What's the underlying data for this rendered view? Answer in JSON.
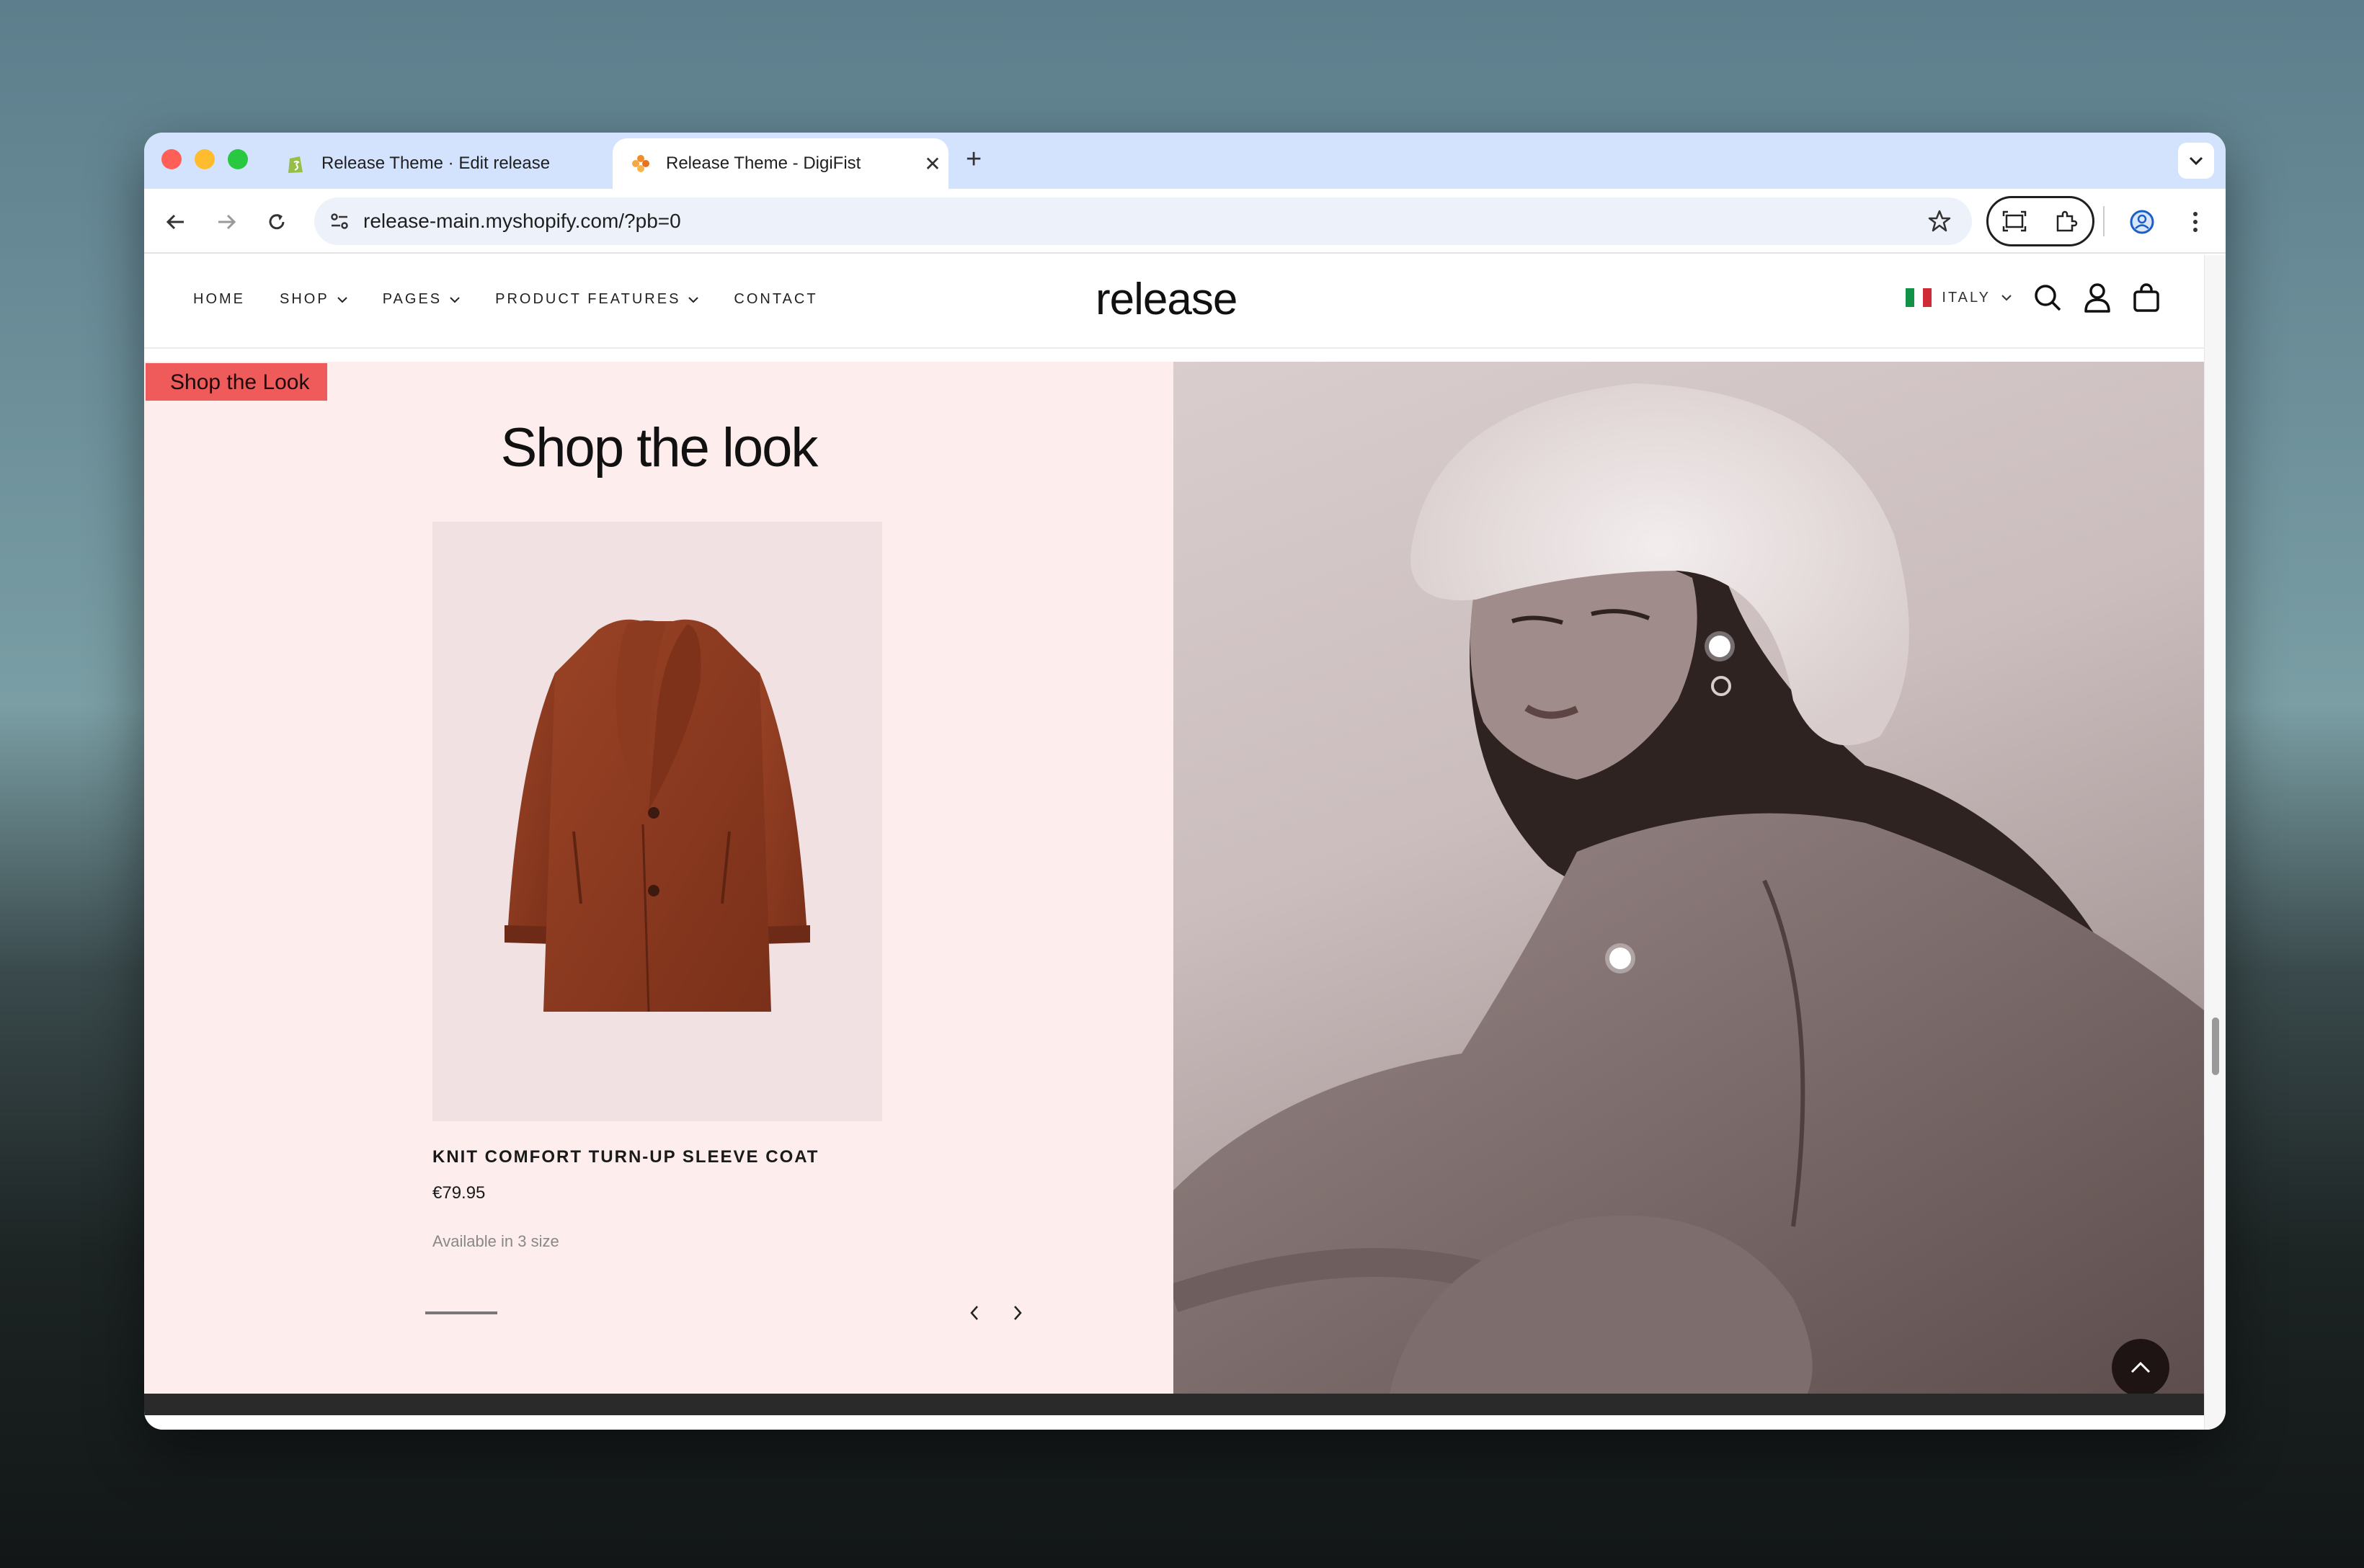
{
  "browser": {
    "tabs": [
      {
        "title": "Release Theme · Edit release",
        "favicon": "shopify-icon",
        "active": false
      },
      {
        "title": "Release Theme - DigiFist",
        "favicon": "digifist-icon",
        "active": true
      }
    ],
    "address": "release-main.myshopify.com/?pb=0"
  },
  "site": {
    "nav": [
      {
        "label": "HOME",
        "has_dropdown": false
      },
      {
        "label": "SHOP",
        "has_dropdown": true
      },
      {
        "label": "PAGES",
        "has_dropdown": true
      },
      {
        "label": "PRODUCT FEATURES",
        "has_dropdown": true
      },
      {
        "label": "CONTACT",
        "has_dropdown": false
      }
    ],
    "logo": "release",
    "country": "ITALY"
  },
  "section": {
    "badge": "Shop the Look",
    "title": "Shop the look",
    "product": {
      "name": "KNIT COMFORT TURN-UP SLEEVE COAT",
      "price": "€79.95",
      "availability": "Available in 3 size"
    }
  },
  "colors": {
    "section_bg": "#fdeded",
    "badge": "#ef5b5b",
    "coat": "#8a3a22",
    "outline": "#e36b6b"
  }
}
